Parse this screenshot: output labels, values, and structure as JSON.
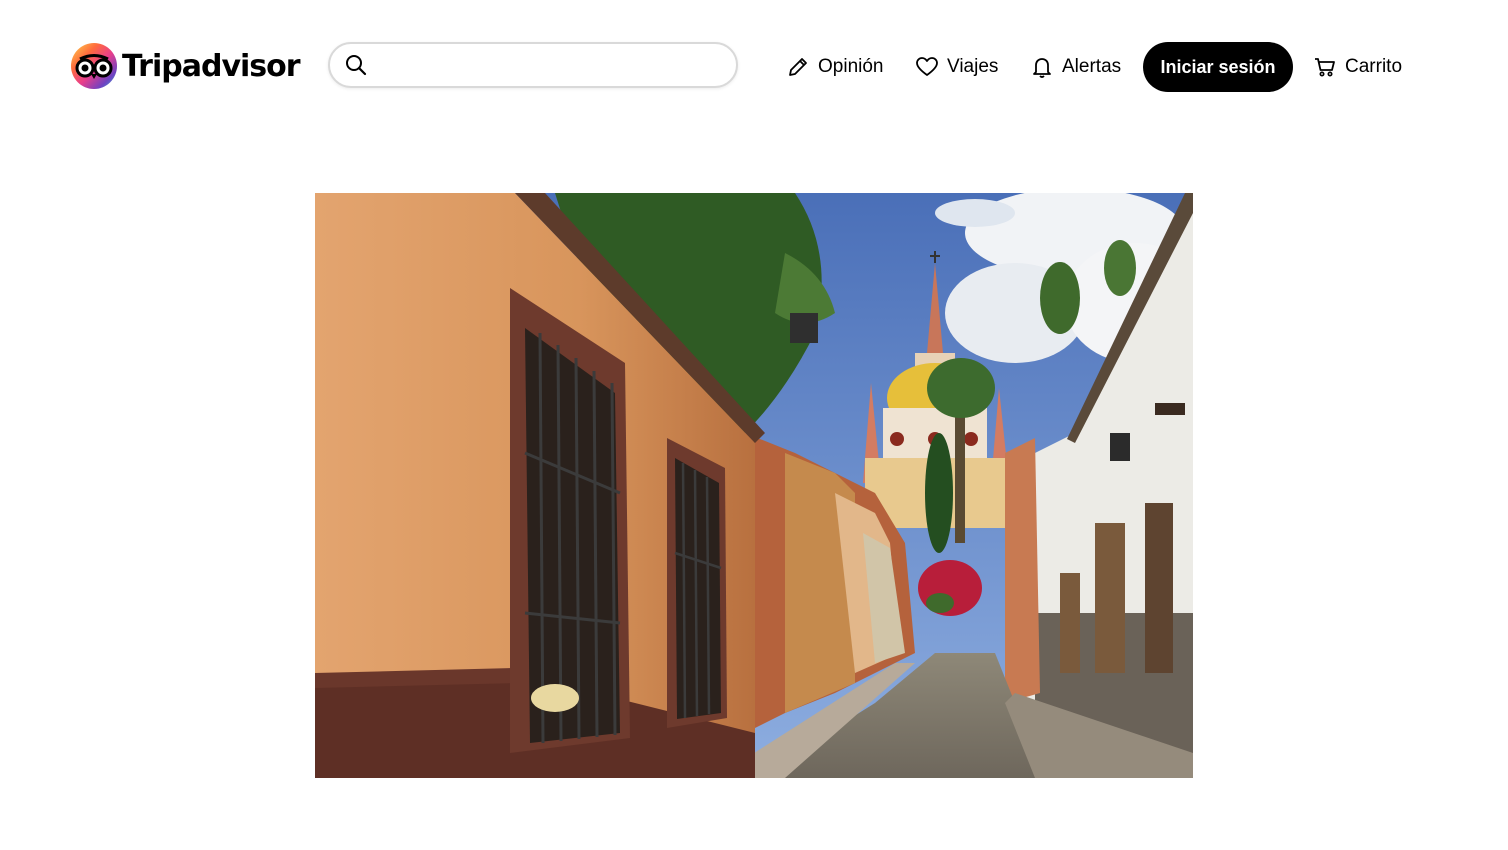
{
  "brand": {
    "name": "Tripadvisor",
    "icon": "owl-logo-icon"
  },
  "search": {
    "placeholder": "",
    "value": "",
    "icon": "search-icon"
  },
  "nav": [
    {
      "label": "Opinión",
      "icon": "pencil-icon"
    },
    {
      "label": "Viajes",
      "icon": "heart-icon"
    },
    {
      "label": "Alertas",
      "icon": "bell-icon"
    }
  ],
  "login_button": {
    "label": "Iniciar sesión"
  },
  "cart": {
    "label": "Carrito",
    "icon": "cart-icon"
  },
  "hero": {
    "subject": "colonial-street-photo"
  },
  "colors": {
    "brand_black": "#000000",
    "border": "#d9d9d9"
  }
}
